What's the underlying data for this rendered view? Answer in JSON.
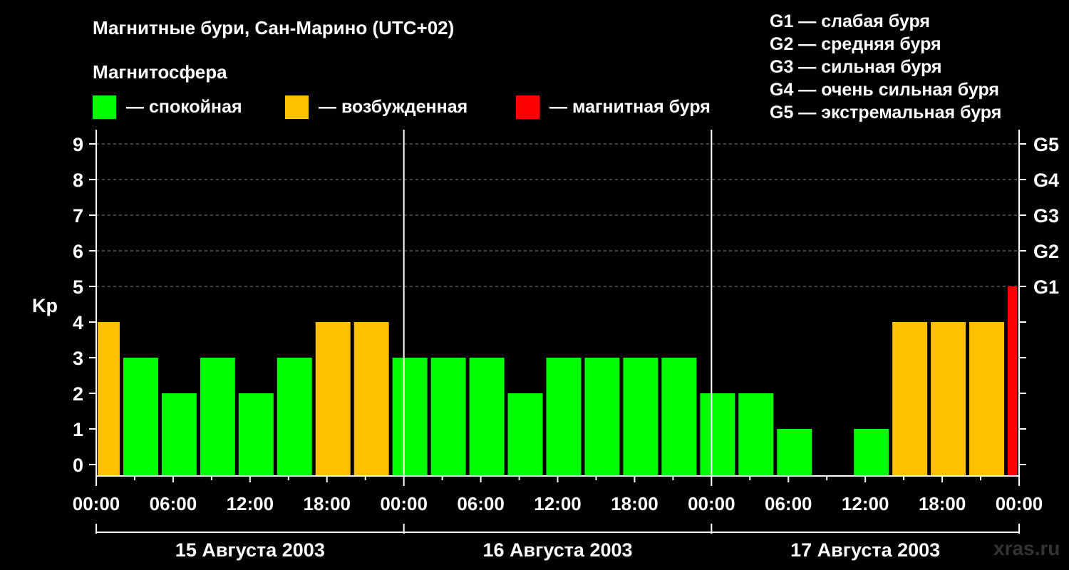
{
  "title": "Магнитные бури, Сан-Марино (UTC+02)",
  "subtitle": "Магнитосфера",
  "legend": [
    {
      "label": "— спокойная",
      "color": "#00ff00"
    },
    {
      "label": "— возбужденная",
      "color": "#ffc000"
    },
    {
      "label": "— магнитная буря",
      "color": "#ff0000"
    }
  ],
  "g_legend": [
    "G1 — слабая буря",
    "G2 — средняя буря",
    "G3 — сильная буря",
    "G4 — очень сильная буря",
    "G5 — экстремальная буря"
  ],
  "watermark": "xras.ru",
  "chart_data": {
    "type": "bar",
    "ylabel": "Kp",
    "ylim": [
      0,
      9
    ],
    "y_ticks": [
      "0",
      "1",
      "2",
      "3",
      "4",
      "5",
      "6",
      "7",
      "8",
      "9"
    ],
    "right_ticks": [
      {
        "value": 5,
        "label": "G1"
      },
      {
        "value": 6,
        "label": "G2"
      },
      {
        "value": 7,
        "label": "G3"
      },
      {
        "value": 8,
        "label": "G4"
      },
      {
        "value": 9,
        "label": "G5"
      }
    ],
    "x_tick_labels": [
      "00:00",
      "06:00",
      "12:00",
      "18:00",
      "00:00",
      "06:00",
      "12:00",
      "18:00",
      "00:00",
      "06:00",
      "12:00",
      "18:00",
      "00:00"
    ],
    "days": [
      "15 Августа 2003",
      "16 Августа 2003",
      "17 Августа 2003"
    ],
    "grid": "dashed horizontal at 5–9",
    "bars": [
      {
        "start_hour": 0,
        "end_hour": 2,
        "value": 4,
        "level": "active"
      },
      {
        "start_hour": 2,
        "end_hour": 5,
        "value": 3,
        "level": "quiet"
      },
      {
        "start_hour": 5,
        "end_hour": 8,
        "value": 2,
        "level": "quiet"
      },
      {
        "start_hour": 8,
        "end_hour": 11,
        "value": 3,
        "level": "quiet"
      },
      {
        "start_hour": 11,
        "end_hour": 14,
        "value": 2,
        "level": "quiet"
      },
      {
        "start_hour": 14,
        "end_hour": 17,
        "value": 3,
        "level": "quiet"
      },
      {
        "start_hour": 17,
        "end_hour": 20,
        "value": 4,
        "level": "active"
      },
      {
        "start_hour": 20,
        "end_hour": 23,
        "value": 4,
        "level": "active"
      },
      {
        "start_hour": 23,
        "end_hour": 26,
        "value": 3,
        "level": "quiet"
      },
      {
        "start_hour": 26,
        "end_hour": 29,
        "value": 3,
        "level": "quiet"
      },
      {
        "start_hour": 29,
        "end_hour": 32,
        "value": 3,
        "level": "quiet"
      },
      {
        "start_hour": 32,
        "end_hour": 35,
        "value": 2,
        "level": "quiet"
      },
      {
        "start_hour": 35,
        "end_hour": 38,
        "value": 3,
        "level": "quiet"
      },
      {
        "start_hour": 38,
        "end_hour": 41,
        "value": 3,
        "level": "quiet"
      },
      {
        "start_hour": 41,
        "end_hour": 44,
        "value": 3,
        "level": "quiet"
      },
      {
        "start_hour": 44,
        "end_hour": 47,
        "value": 3,
        "level": "quiet"
      },
      {
        "start_hour": 47,
        "end_hour": 50,
        "value": 2,
        "level": "quiet"
      },
      {
        "start_hour": 50,
        "end_hour": 53,
        "value": 2,
        "level": "quiet"
      },
      {
        "start_hour": 53,
        "end_hour": 56,
        "value": 1,
        "level": "quiet"
      },
      {
        "start_hour": 56,
        "end_hour": 59,
        "value": 0,
        "level": "quiet"
      },
      {
        "start_hour": 59,
        "end_hour": 62,
        "value": 1,
        "level": "quiet"
      },
      {
        "start_hour": 62,
        "end_hour": 65,
        "value": 4,
        "level": "active"
      },
      {
        "start_hour": 65,
        "end_hour": 68,
        "value": 4,
        "level": "active"
      },
      {
        "start_hour": 68,
        "end_hour": 71,
        "value": 4,
        "level": "active"
      },
      {
        "start_hour": 71,
        "end_hour": 72,
        "value": 5,
        "level": "storm"
      }
    ],
    "level_colors": {
      "quiet": "#00ff00",
      "active": "#ffc000",
      "storm": "#ff0000"
    }
  }
}
